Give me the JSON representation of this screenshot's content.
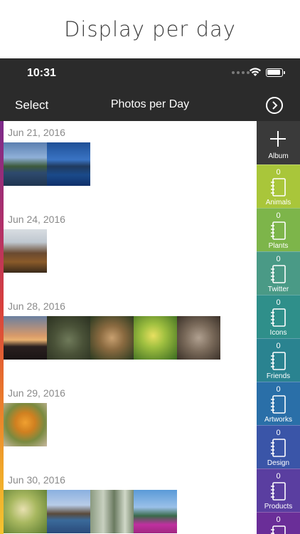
{
  "caption": "Display per day",
  "status": {
    "time": "10:31"
  },
  "nav": {
    "select_label": "Select",
    "title": "Photos per Day"
  },
  "sidebar": {
    "add_label": "Album",
    "albums": [
      {
        "count": "0",
        "name": "Animals",
        "color": "#a9c63a"
      },
      {
        "count": "0",
        "name": "Plants",
        "color": "#7db54a"
      },
      {
        "count": "0",
        "name": "Twitter",
        "color": "#4a9a86"
      },
      {
        "count": "0",
        "name": "Icons",
        "color": "#2f8f8a"
      },
      {
        "count": "0",
        "name": "Friends",
        "color": "#2a8390"
      },
      {
        "count": "0",
        "name": "Artworks",
        "color": "#2a6fa8"
      },
      {
        "count": "0",
        "name": "Design",
        "color": "#3a55a8"
      },
      {
        "count": "0",
        "name": "Products",
        "color": "#5a3ea0"
      },
      {
        "count": "0",
        "name": "",
        "color": "#6a2e98"
      }
    ]
  },
  "days": [
    {
      "date": "Jun 21, 2016",
      "photos": [
        "lake-photo",
        "mountain-lake-photo"
      ]
    },
    {
      "date": "Jun 24, 2016",
      "photos": [
        "carousel-photo"
      ]
    },
    {
      "date": "Jun 28, 2016",
      "photos": [
        "sunset-church-photo",
        "crocodile-photo",
        "monkey-photo",
        "leaf-bud-photo",
        "cat-photo"
      ]
    },
    {
      "date": "Jun 29, 2016",
      "photos": [
        "insect-flower-photo"
      ]
    },
    {
      "date": "Jun 30, 2016",
      "photos": [
        "bird-photo",
        "lake-photo-2",
        "trees-photo",
        "flowers-pond-photo"
      ]
    }
  ]
}
